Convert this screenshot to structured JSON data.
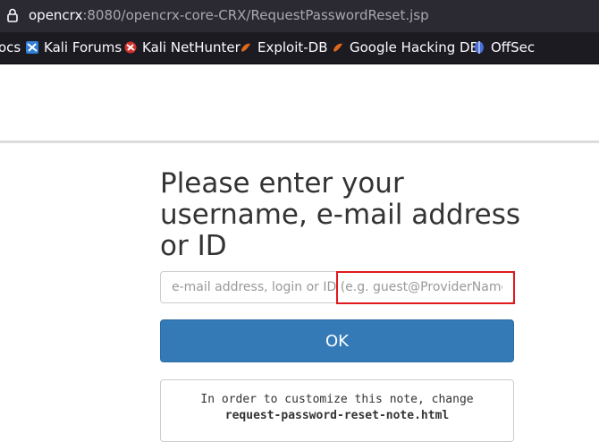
{
  "browser": {
    "url_host": "opencrx",
    "url_rest": ":8080/opencrx-core-CRX/RequestPasswordReset.jsp",
    "bookmarks": [
      {
        "label": "ocs",
        "icon": "docs-icon"
      },
      {
        "label": "Kali Forums",
        "icon": "kali-forums-icon"
      },
      {
        "label": "Kali NetHunter",
        "icon": "kali-nethunter-icon"
      },
      {
        "label": "Exploit-DB",
        "icon": "exploit-db-icon"
      },
      {
        "label": "Google Hacking DB",
        "icon": "google-hacking-db-icon"
      },
      {
        "label": "OffSec",
        "icon": "offsec-icon"
      }
    ]
  },
  "form": {
    "title": "Please enter your username, e-mail address or ID",
    "input_placeholder": "e-mail address, login or ID (e.g. guest@ProviderName)",
    "submit_label": "OK",
    "note_line1": "In order to customize this note, change",
    "note_file": "request-password-reset-note.html"
  },
  "colors": {
    "primary": "#337ab7",
    "highlight": "#e0191f"
  }
}
